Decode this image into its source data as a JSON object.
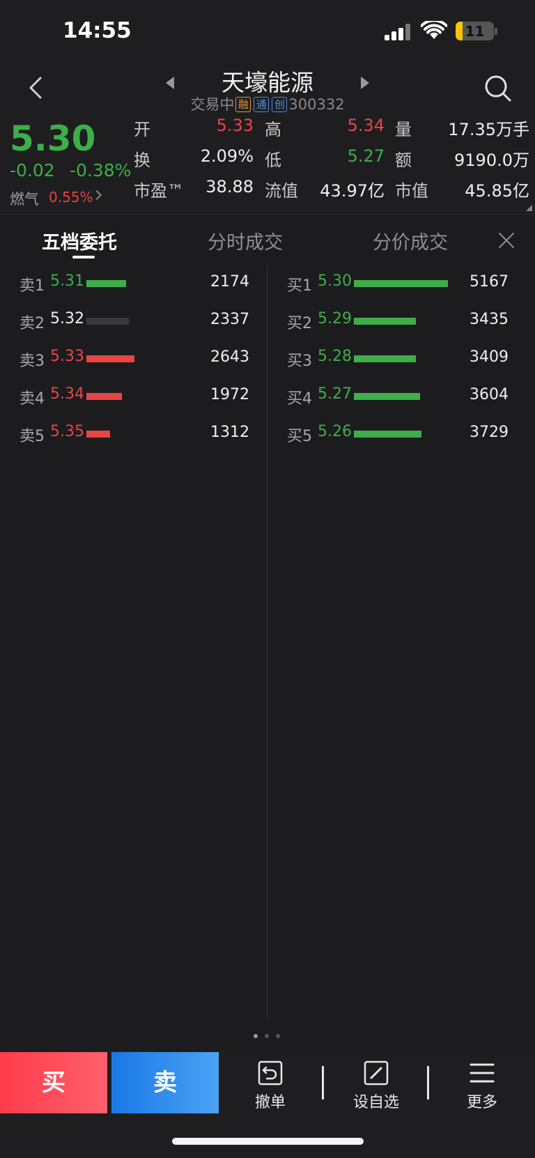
{
  "status_bar": {
    "time": "14:55",
    "battery": "11"
  },
  "header": {
    "stock_name": "天壕能源",
    "trading_status": "交易中",
    "tags": [
      "融",
      "通",
      "创"
    ],
    "stock_code": "300332"
  },
  "quote": {
    "price": "5.30",
    "change": "-0.02",
    "change_pct": "-0.38%",
    "sector": "燃气",
    "sector_pct": "0.55%",
    "open_label": "开",
    "open": "5.33",
    "high_label": "高",
    "high": "5.34",
    "volume_label": "量",
    "volume": "17.35万手",
    "turnover_label": "换",
    "turnover": "2.09%",
    "low_label": "低",
    "low": "5.27",
    "amount_label": "额",
    "amount": "9190.0万",
    "pe_label": "市盈™",
    "pe": "38.88",
    "float_cap_label": "流值",
    "float_cap": "43.97亿",
    "mkt_cap_label": "市值",
    "mkt_cap": "45.85亿"
  },
  "tabs": [
    "五档委托",
    "分时成交",
    "分价成交"
  ],
  "order_book": {
    "sell": [
      {
        "label": "卖1",
        "price": "5.31",
        "volume": "2174",
        "level": 0.42,
        "color": "#3dae49"
      },
      {
        "label": "卖2",
        "price": "5.32",
        "volume": "2337",
        "level": 0.45,
        "color": "#3a3a3c"
      },
      {
        "label": "卖3",
        "price": "5.33",
        "volume": "2643",
        "level": 0.51,
        "color": "#e84545"
      },
      {
        "label": "卖4",
        "price": "5.34",
        "volume": "1972",
        "level": 0.38,
        "color": "#e84545"
      },
      {
        "label": "卖5",
        "price": "5.35",
        "volume": "1312",
        "level": 0.25,
        "color": "#e84545"
      }
    ],
    "buy": [
      {
        "label": "买1",
        "price": "5.30",
        "volume": "5167",
        "level": 1.0,
        "color": "#3dae49"
      },
      {
        "label": "买2",
        "price": "5.29",
        "volume": "3435",
        "level": 0.66,
        "color": "#3dae49"
      },
      {
        "label": "买3",
        "price": "5.28",
        "volume": "3409",
        "level": 0.66,
        "color": "#3dae49"
      },
      {
        "label": "买4",
        "price": "5.27",
        "volume": "3604",
        "level": 0.7,
        "color": "#3dae49"
      },
      {
        "label": "买5",
        "price": "5.26",
        "volume": "3729",
        "level": 0.72,
        "color": "#3dae49"
      }
    ]
  },
  "bottom_bar": {
    "buy": "买",
    "sell": "卖",
    "cancel_order": "撤单",
    "add_watchlist": "设自选",
    "more": "更多"
  },
  "colors": {
    "up": "#e84545",
    "down": "#3dae49",
    "buy_button": "#ff3b4a",
    "sell_button": "#1a78e6"
  }
}
